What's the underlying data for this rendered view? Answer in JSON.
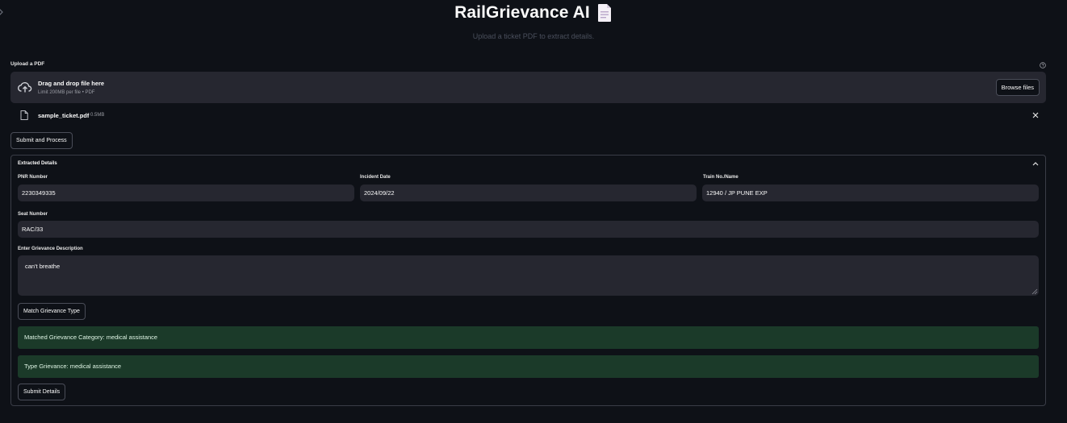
{
  "app": {
    "title": "RailGrievance AI",
    "title_emoji": "document-emoji",
    "subtitle": "Upload a ticket PDF to extract details."
  },
  "uploader": {
    "label": "Upload a PDF",
    "drop_title": "Drag and drop file here",
    "drop_limit": "Limit 200MB per file • PDF",
    "browse_label": "Browse files",
    "file": {
      "name": "sample_ticket.pdf",
      "size": "0.5MB"
    }
  },
  "submit_process_label": "Submit and Process",
  "extracted": {
    "title": "Extracted Details",
    "fields": {
      "pnr": {
        "label": "PNR Number",
        "value": "2230349335"
      },
      "incident_date": {
        "label": "Incident Date",
        "value": "2024/09/22"
      },
      "train": {
        "label": "Train No./Name",
        "value": "12940 / JP PUNE EXP"
      },
      "seat": {
        "label": "Seat Number",
        "value": "RAC/33"
      },
      "description": {
        "label": "Enter Grievance Description",
        "value": "can't breathe"
      }
    },
    "match_button_label": "Match Grievance Type",
    "matched_category_text": "Matched Grievance Category: medical assistance",
    "type_grievance_text": "Type Grievance: medical assistance",
    "submit_details_label": "Submit Details"
  },
  "colors": {
    "background": "#0e1117",
    "surface": "#262730",
    "success_bg": "#1b3a29",
    "text": "#fafafa"
  }
}
